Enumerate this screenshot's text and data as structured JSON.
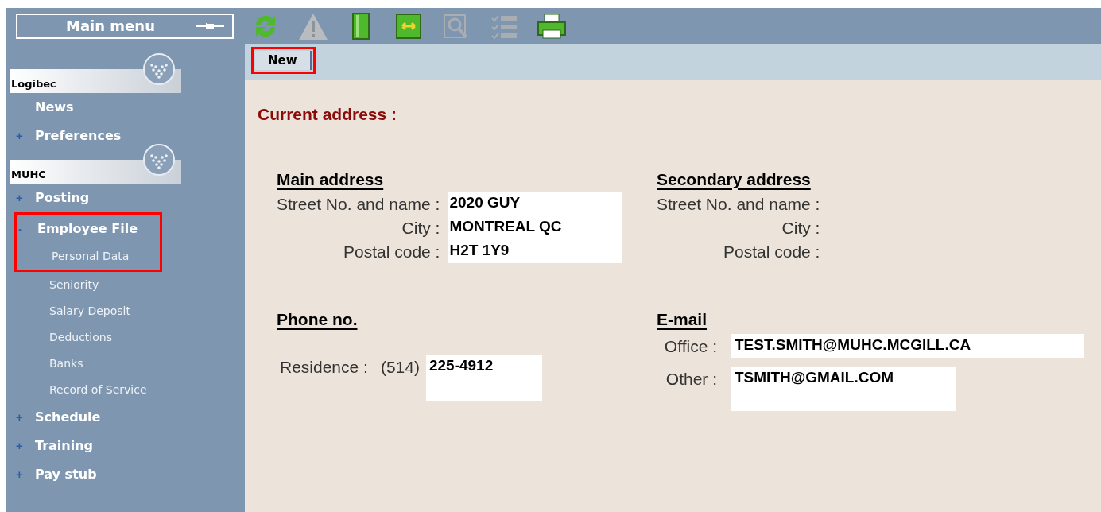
{
  "sidebar": {
    "title": "Main menu",
    "groups": [
      {
        "name": "Logibec",
        "items": [
          {
            "label": "News",
            "marker": ""
          },
          {
            "label": "Preferences",
            "marker": "+"
          }
        ]
      },
      {
        "name": "MUHC",
        "items": [
          {
            "label": "Posting",
            "marker": "+"
          },
          {
            "label": "Employee File",
            "marker": "-",
            "highlighted": true,
            "children": [
              {
                "label": "Personal Data"
              },
              {
                "label": "Seniority"
              },
              {
                "label": "Salary Deposit"
              },
              {
                "label": "Deductions"
              },
              {
                "label": "Banks"
              },
              {
                "label": "Record of Service"
              }
            ]
          },
          {
            "label": "Schedule",
            "marker": "+"
          },
          {
            "label": "Training",
            "marker": "+"
          },
          {
            "label": "Pay stub",
            "marker": "+"
          }
        ]
      }
    ]
  },
  "toolbar": [
    {
      "kind": "refresh",
      "disabled": false
    },
    {
      "kind": "warning",
      "disabled": true
    },
    {
      "kind": "book",
      "disabled": false
    },
    {
      "kind": "split",
      "disabled": false
    },
    {
      "kind": "search",
      "disabled": true
    },
    {
      "kind": "list",
      "disabled": true
    },
    {
      "kind": "print",
      "disabled": false
    }
  ],
  "tabs": [
    {
      "label": "New",
      "highlighted": true
    }
  ],
  "content": {
    "title": "Current address :",
    "main_address": {
      "heading": "Main address",
      "fields": [
        {
          "label": "Street No. and name :",
          "value": "2020 GUY"
        },
        {
          "label": "City :",
          "value": "MONTREAL QC"
        },
        {
          "label": "Postal code :",
          "value": "H2T 1Y9"
        }
      ]
    },
    "secondary_address": {
      "heading": "Secondary address",
      "fields": [
        {
          "label": "Street No. and name :"
        },
        {
          "label": "City :"
        },
        {
          "label": "Postal code :"
        }
      ]
    },
    "phone": {
      "heading": "Phone no.",
      "label": "Residence :",
      "area": "(514)",
      "value": "225-4912"
    },
    "email": {
      "heading": "E-mail",
      "fields": [
        {
          "label": "Office :",
          "value": "TEST.SMITH@MUHC.MCGILL.CA"
        },
        {
          "label": "Other :",
          "value": "TSMITH@GMAIL.COM"
        }
      ]
    }
  }
}
